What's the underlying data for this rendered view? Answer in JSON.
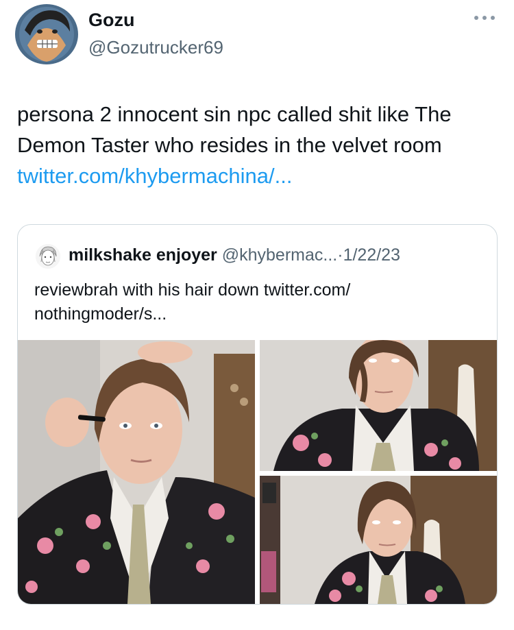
{
  "author": {
    "name": "Gozu",
    "handle": "@Gozutrucker69",
    "avatar_icon": "avatar-illustration"
  },
  "more_icon": "more-horizontal-icon",
  "tweet": {
    "lines": [
      "persona 2 innocent sin npc called shit like The",
      "Demon Taster who resides in the velvet room"
    ],
    "link": "twitter.com/khybermachina/..."
  },
  "quoted": {
    "name": "milkshake enjoyer",
    "handle": "@khybermac...",
    "separator": "·",
    "date": "1/22/23",
    "text_lines": [
      "reviewbrah with his hair down twitter.com/",
      "nothingmoder/s..."
    ],
    "media_count": 3
  },
  "colors": {
    "link": "#1d9bf0",
    "secondary_text": "#536471",
    "border": "#cfd9de"
  }
}
